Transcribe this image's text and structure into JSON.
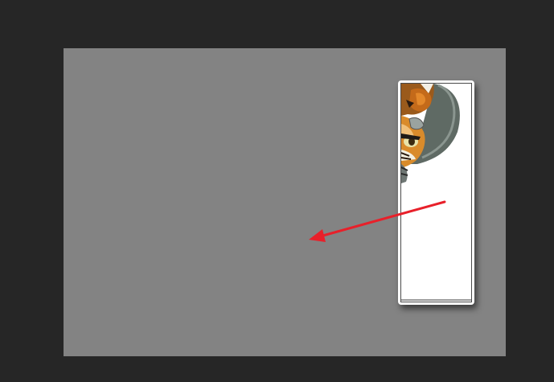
{
  "workspace": {
    "background": "#262626"
  },
  "canvas": {
    "background": "#838383"
  },
  "layer": {
    "content": "tiger-character-cutout",
    "background": "#ffffff"
  },
  "annotation": {
    "type": "arrow",
    "color": "#e8202a",
    "direction": "left"
  }
}
